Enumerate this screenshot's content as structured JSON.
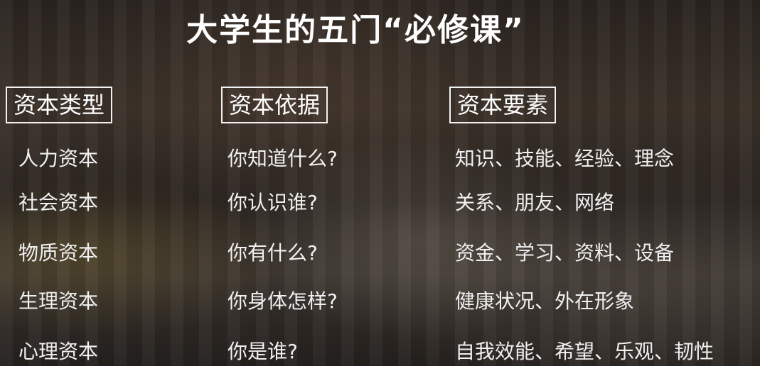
{
  "title": "大学生的五门“必修课”",
  "columns": [
    {
      "header": "资本类型",
      "rows": [
        "人力资本",
        "社会资本",
        "物质资本",
        "生理资本",
        "心理资本"
      ]
    },
    {
      "header": "资本依据",
      "rows": [
        "你知道什么?",
        "你认识谁?",
        "你有什么?",
        "你身体怎样?",
        "你是谁?"
      ]
    },
    {
      "header": "资本要素",
      "rows": [
        "知识、技能、经验、理念",
        "关系、朋友、网络",
        "资金、学习、资料、设备",
        "健康状况、外在形象",
        "自我效能、希望、乐观、韧性"
      ]
    }
  ]
}
